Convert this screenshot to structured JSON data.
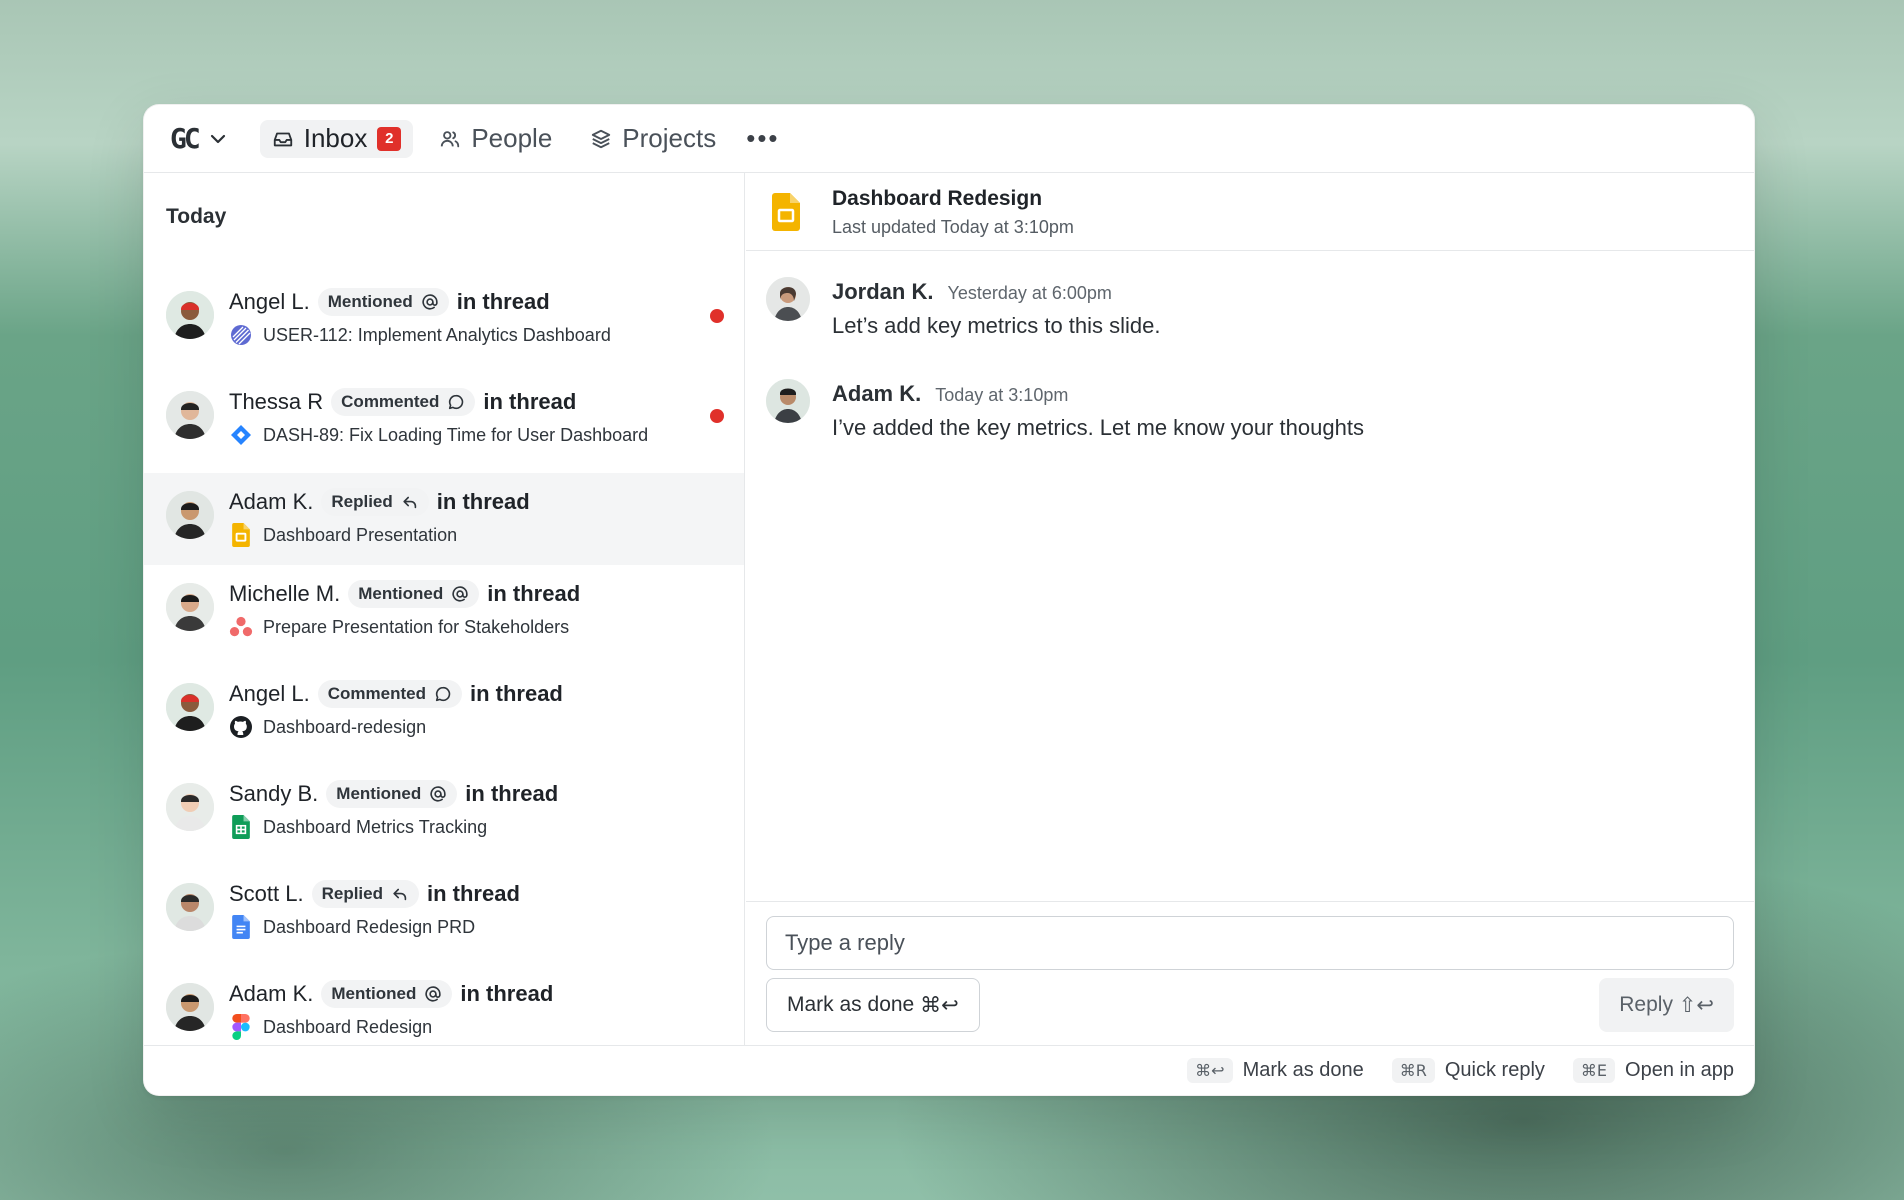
{
  "topbar": {
    "logo": "GC",
    "tabs": [
      {
        "label": "Inbox",
        "badge": "2",
        "icon": "inbox-icon"
      },
      {
        "label": "People",
        "icon": "people-icon"
      },
      {
        "label": "Projects",
        "icon": "layers-icon"
      }
    ],
    "more": "•••"
  },
  "inbox": {
    "section_title": "Today",
    "items": [
      {
        "name": "Angel L.",
        "action": "Mentioned",
        "action_icon": "at-icon",
        "suffix": "in thread",
        "source": "USER-112: Implement Analytics Dashboard",
        "source_icon": "linear-icon",
        "unread": true
      },
      {
        "name": "Thessa R",
        "action": "Commented",
        "action_icon": "comment-icon",
        "suffix": "in thread",
        "source": "DASH-89: Fix Loading Time for User Dashboard",
        "source_icon": "jira-icon",
        "unread": true
      },
      {
        "name": "Adam K.",
        "action": "Replied",
        "action_icon": "reply-icon",
        "suffix": "in thread",
        "source": "Dashboard Presentation",
        "source_icon": "google-slides-icon",
        "unread": false
      },
      {
        "name": "Michelle M.",
        "action": "Mentioned",
        "action_icon": "at-icon",
        "suffix": "in thread",
        "source": "Prepare Presentation for Stakeholders",
        "source_icon": "asana-icon",
        "unread": false
      },
      {
        "name": "Angel L.",
        "action": "Commented",
        "action_icon": "comment-icon",
        "suffix": "in thread",
        "source": "Dashboard-redesign",
        "source_icon": "github-icon",
        "unread": false
      },
      {
        "name": "Sandy B.",
        "action": "Mentioned",
        "action_icon": "at-icon",
        "suffix": "in thread",
        "source": "Dashboard Metrics Tracking",
        "source_icon": "google-sheets-icon",
        "unread": false
      },
      {
        "name": "Scott L.",
        "action": "Replied",
        "action_icon": "reply-icon",
        "suffix": "in thread",
        "source": "Dashboard Redesign PRD",
        "source_icon": "google-docs-icon",
        "unread": false
      },
      {
        "name": "Adam K.",
        "action": "Mentioned",
        "action_icon": "at-icon",
        "suffix": "in thread",
        "source": "Dashboard Redesign",
        "source_icon": "figma-icon",
        "unread": false
      }
    ]
  },
  "thread": {
    "title": "Dashboard Redesign",
    "subtitle": "Last updated Today at 3:10pm",
    "messages": [
      {
        "name": "Jordan K.",
        "time": "Yesterday at 6:00pm",
        "text": "Let’s add key metrics to this slide."
      },
      {
        "name": "Adam K.",
        "time": "Today at 3:10pm",
        "text": "I’ve added the key metrics. Let me know your thoughts"
      }
    ]
  },
  "composer": {
    "placeholder": "Type a reply",
    "mark_done_label": "Mark as done",
    "mark_done_shortcut": "⌘↩",
    "reply_label": "Reply",
    "reply_shortcut": "⇧↩"
  },
  "footer": {
    "hints": [
      {
        "key": "⌘↩",
        "label": "Mark as done"
      },
      {
        "key": "⌘R",
        "label": "Quick reply"
      },
      {
        "key": "⌘E",
        "label": "Open in app"
      }
    ]
  },
  "colors": {
    "accent_red": "#e0302a",
    "selected_row": "#f4f5f6"
  }
}
